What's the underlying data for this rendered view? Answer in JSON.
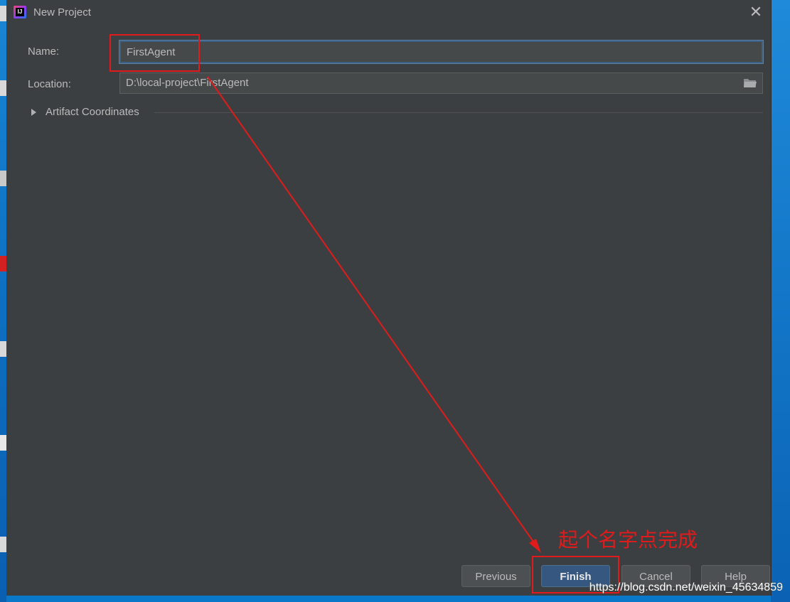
{
  "dialog": {
    "title": "New Project",
    "close_icon": "close-icon"
  },
  "form": {
    "name_label": "Name:",
    "name_value": "FirstAgent",
    "location_label": "Location:",
    "location_value": "D:\\local-project\\FirstAgent",
    "folder_icon": "folder-icon",
    "artifact_label": "Artifact Coordinates"
  },
  "buttons": {
    "previous": "Previous",
    "finish": "Finish",
    "cancel": "Cancel",
    "help": "Help"
  },
  "annotation": {
    "text": "起个名字点完成",
    "color": "#e01b1b"
  },
  "watermark": "https://blog.csdn.net/weixin_45634859",
  "colors": {
    "dialog_bg": "#3c3f41",
    "primary_button": "#365880",
    "desktop": "#0a78c8"
  }
}
